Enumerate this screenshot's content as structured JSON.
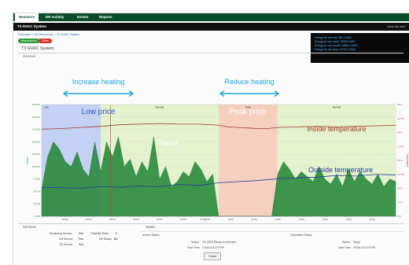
{
  "nav": {
    "tabs": [
      {
        "label": "Resource",
        "active": true
      },
      {
        "label": "DR Activity",
        "active": false
      },
      {
        "label": "Events",
        "active": false
      },
      {
        "label": "Reports",
        "active": false
      }
    ]
  },
  "titlebar": {
    "title": "T3 HVAC System",
    "right": "close the view"
  },
  "breadcrumb": "Resource > My Resources > T3 HVAC System",
  "chips": [
    {
      "label": "Measurement",
      "color": "#2e9b3a"
    },
    {
      "label": "Offline",
      "color": "#d9312a"
    }
  ],
  "page_title": "T3 HVAC System",
  "general_label": "General",
  "energy_lines": [
    "Energy for one min: 987.0 kWh",
    "Energy for one week: 3835.0 kWh",
    "Energy for one month: 15861.0 kWh",
    "Energy for one year: 41232.0 kWh"
  ],
  "annotations": {
    "increase": "Increase heating",
    "reduce": "Reduce heating",
    "low_price": "Low price",
    "peak_price": "Peak price",
    "power": "Power",
    "inside": "Inside temperature",
    "outside": "Outside temperature"
  },
  "chart_data": {
    "type": "area",
    "regions": [
      {
        "label": "Low",
        "from": "00:00",
        "to": "03:00",
        "color": "#b9c9f2"
      },
      {
        "label": "Normal",
        "from": "03:00",
        "to": "09:00",
        "color": "#dff0c4"
      },
      {
        "label": "Peak",
        "from": "09:00",
        "to": "12:00",
        "color": "#f5c8b4"
      },
      {
        "label": "Normal",
        "from": "12:00",
        "to": "18:00",
        "color": "#dff0c4"
      }
    ],
    "x_ticks": [
      "03:00",
      "04:00",
      "05:00",
      "06:00",
      "07:00",
      "08:00",
      "09:00",
      "10:00",
      "11:00",
      "12:00",
      "13:00",
      "14:00",
      "15:00",
      "16:00"
    ],
    "y_left_ticks": [
      "0 kW",
      "25 kW",
      "50 kW",
      "75 kW",
      "100 kW",
      "125 kW",
      "150 kW",
      "175 kW",
      "200 kW",
      "225 kW"
    ],
    "y_right_ticks": [
      "5°C",
      "7.5°C",
      "10°C",
      "12.5°C",
      "15°C",
      "17.5°C",
      "20°C",
      "22.5°C",
      "25°C"
    ],
    "ylim_left": [
      0,
      225
    ],
    "ylim_right": [
      5,
      25
    ],
    "ylabel_left": "Power",
    "ylabel_right": "Temperature",
    "xlabel": "Time",
    "series": [
      {
        "name": "Power",
        "color": "#2b8a3e",
        "x": [
          0,
          0.3,
          0.6,
          0.9,
          1.2,
          1.5,
          1.8,
          2.1,
          2.4,
          2.7,
          3.0,
          3.3,
          3.6,
          3.9,
          4.2,
          4.5,
          4.8,
          5.1,
          5.4,
          5.7,
          6.0,
          6.3,
          6.6,
          6.9,
          7.2,
          7.5,
          7.8,
          8.1,
          8.4,
          8.7,
          9.0,
          9.3,
          9.6,
          9.9,
          10.2,
          10.5,
          10.8,
          11.1,
          11.4,
          11.7,
          12.0,
          12.3,
          12.6,
          12.9,
          13.2,
          13.5,
          13.8,
          14.1,
          14.4,
          14.7,
          15.0,
          15.3,
          15.6,
          15.9,
          16.2,
          16.5,
          16.8,
          17.1,
          17.4,
          17.7,
          18.0
        ],
        "values": [
          55,
          120,
          150,
          135,
          110,
          100,
          130,
          95,
          80,
          150,
          90,
          150,
          120,
          160,
          100,
          115,
          80,
          110,
          90,
          160,
          75,
          100,
          60,
          70,
          90,
          80,
          110,
          95,
          70,
          85,
          0,
          0,
          0,
          0,
          0,
          0,
          0,
          0,
          0,
          0,
          85,
          110,
          95,
          75,
          90,
          80,
          70,
          100,
          75,
          65,
          85,
          60,
          95,
          70,
          90,
          75,
          65,
          85,
          60,
          75,
          70
        ]
      },
      {
        "name": "Inside temperature",
        "color": "#a23b2c",
        "x": [
          0,
          1,
          2,
          3,
          4,
          5,
          6,
          7,
          8,
          9,
          9.5,
          10,
          10.5,
          11,
          11.5,
          12,
          13,
          14,
          15,
          16,
          17,
          18
        ],
        "values": [
          20.6,
          20.7,
          20.9,
          21.1,
          21.4,
          21.5,
          21.6,
          21.5,
          21.5,
          21.3,
          21.0,
          20.9,
          20.8,
          20.7,
          20.7,
          20.9,
          21.0,
          21.1,
          21.0,
          21.1,
          21.2,
          21.3
        ]
      },
      {
        "name": "Outside temperature",
        "color": "#223a9a",
        "x": [
          0,
          1,
          2,
          3,
          4,
          5,
          6,
          7,
          8,
          9,
          10,
          11,
          12,
          13,
          14,
          15,
          16,
          17,
          18
        ],
        "values": [
          10.2,
          10.1,
          10.0,
          10.3,
          10.2,
          10.4,
          10.3,
          10.7,
          10.5,
          11.0,
          11.2,
          11.4,
          11.7,
          11.9,
          12.0,
          12.3,
          12.2,
          12.5,
          12.4
        ]
      }
    ]
  },
  "services": {
    "title": "Services",
    "rows": [
      {
        "label": "Monitoring Service:",
        "value": "Yes",
        "label2": "Flexibility Ratio:",
        "value2": "0"
      },
      {
        "label": "DR Service:",
        "value": "Yes",
        "label2": "DR Ready:",
        "value2": "No"
      },
      {
        "label": "TM Service:",
        "value": "Yes"
      }
    ]
  },
  "status": {
    "title": "Status",
    "access_title": "Access Status",
    "override_title": "Overridden Status",
    "access_status_label": "Status:",
    "access_status_value": "OK (DER Ready to execute)",
    "access_time_label": "Start Time:",
    "access_time_value": "2/4/14 5:41:19 PM",
    "override_status_label": "Status:",
    "override_status_value": "Sleep",
    "override_time_label": "Start Time:",
    "override_time_value": "2/4/14 5:41:19 PM"
  },
  "close_label": "Close"
}
